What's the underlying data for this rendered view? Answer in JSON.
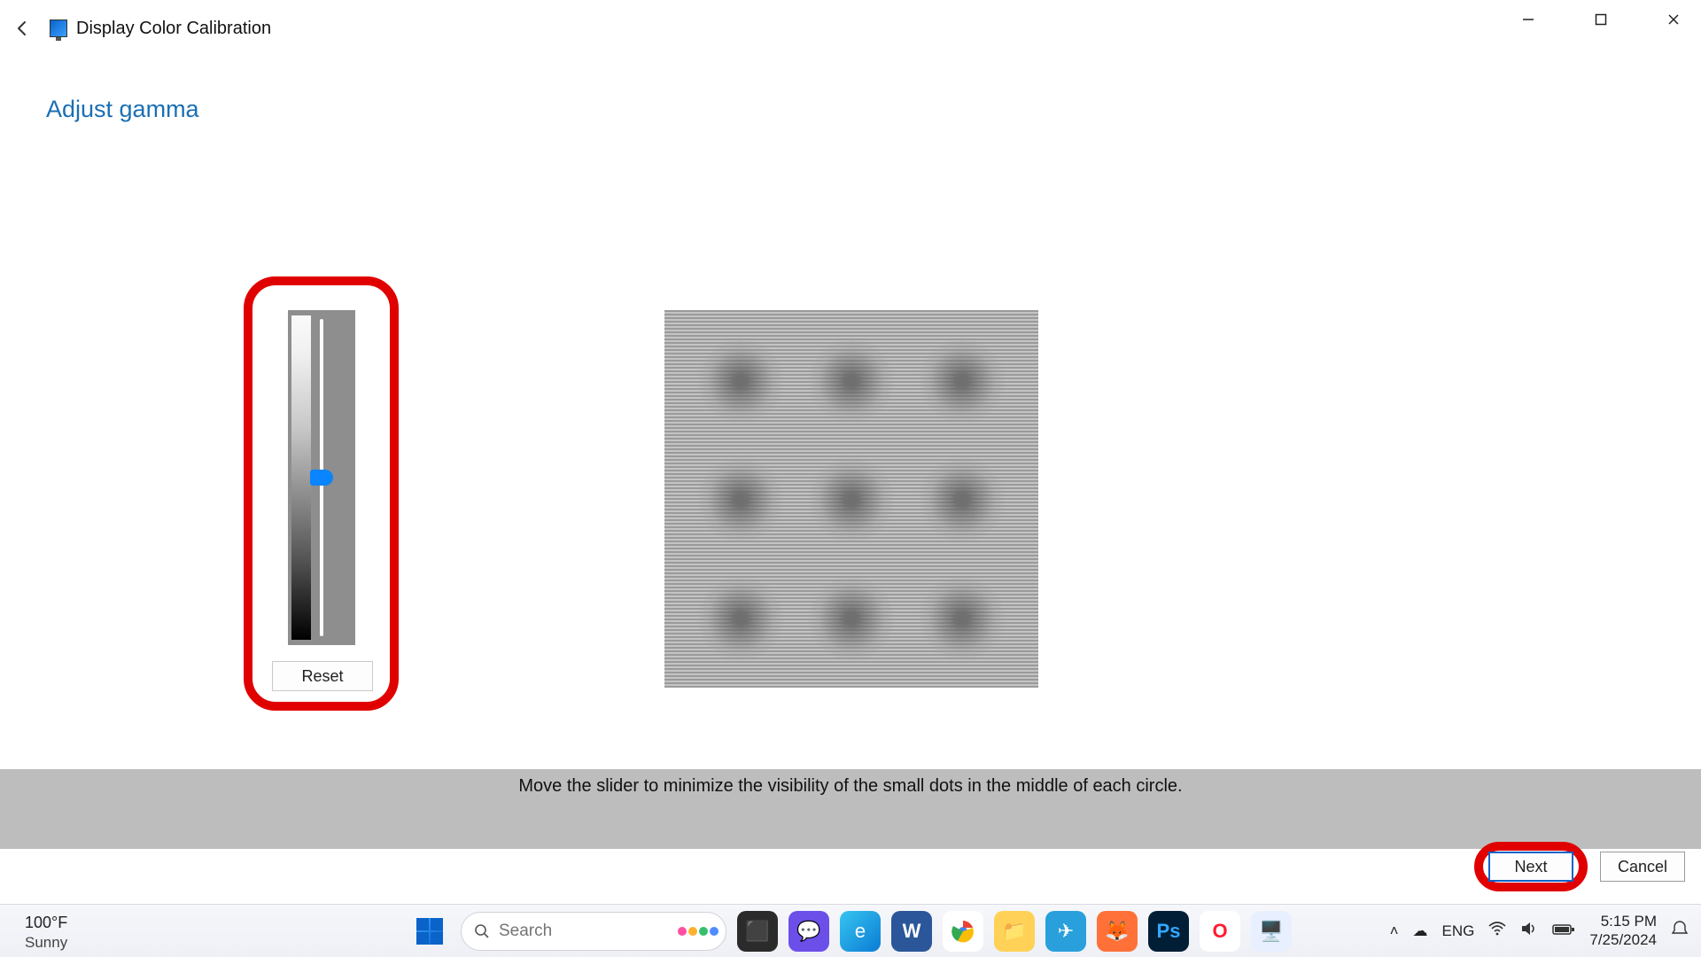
{
  "window": {
    "title": "Display Color Calibration",
    "heading": "Adjust gamma",
    "instruction": "Move the slider to minimize the visibility of the small dots in the middle of each circle."
  },
  "controls": {
    "reset_label": "Reset",
    "next_label": "Next",
    "cancel_label": "Cancel"
  },
  "slider": {
    "value_percent": 50
  },
  "taskbar": {
    "weather_temp": "100°F",
    "weather_cond": "Sunny",
    "search_placeholder": "Search",
    "lang": "ENG",
    "time": "5:15 PM",
    "date": "7/25/2024"
  }
}
